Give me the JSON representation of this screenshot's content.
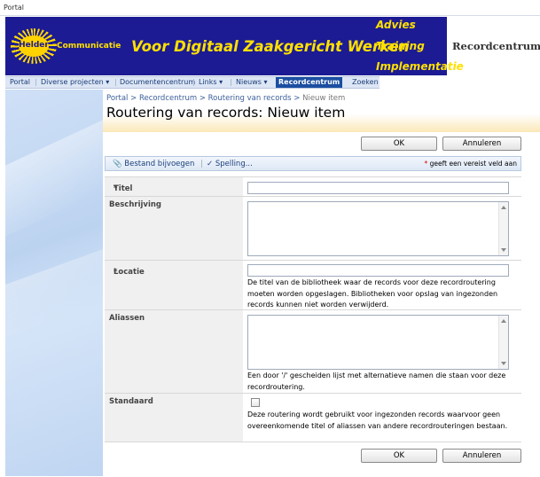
{
  "window": {
    "title": "Portal"
  },
  "banner": {
    "logo_text": "Helder",
    "logo_suffix": "Communicatie",
    "slogan": "Voor Digitaal Zaakgericht Werken",
    "taglines": [
      "Advies",
      "Training",
      "Implementatie"
    ],
    "site_name": "Recordcentrum"
  },
  "nav": {
    "items": [
      {
        "label": "Portal"
      },
      {
        "label": "Diverse projecten",
        "dropdown": true
      },
      {
        "label": "Documentencentrum"
      },
      {
        "label": "Links",
        "dropdown": true
      },
      {
        "label": "Nieuws",
        "dropdown": true
      },
      {
        "label": "Recordcentrum",
        "selected": true
      },
      {
        "label": "Zoeken"
      }
    ]
  },
  "breadcrumb": {
    "items": [
      "Portal",
      "Recordcentrum",
      "Routering van records",
      "Nieuw item"
    ],
    "separator": ">"
  },
  "page": {
    "title": "Routering van records: Nieuw item"
  },
  "buttons": {
    "ok": "OK",
    "cancel": "Annuleren"
  },
  "toolbar": {
    "attach": "Bestand bijvoegen",
    "spelling": "Spelling...",
    "required_note": "geeft een vereist veld aan"
  },
  "form": {
    "title_label": "Titel",
    "title_value": "",
    "description_label": "Beschrijving",
    "description_value": "",
    "location_label": "Locatie",
    "location_value": "",
    "location_help": "De titel van de bibliotheek waar de records voor deze recordroutering moeten worden opgeslagen. Bibliotheken voor opslag van ingezonden records kunnen niet worden verwijderd.",
    "aliases_label": "Aliassen",
    "aliases_value": "",
    "aliases_help": "Een door '/' gescheiden lijst met alternatieve namen die staan voor deze recordroutering.",
    "default_label": "Standaard",
    "default_checked": false,
    "default_help": "Deze routering wordt gebruikt voor ingezonden records waarvoor geen overeenkomende titel of aliassen van andere recordrouteringen bestaan."
  },
  "colors": {
    "banner_bg": "#1c1b93",
    "banner_text": "#ffe000",
    "nav_selected": "#1a4ea1",
    "required": "#d10000"
  }
}
